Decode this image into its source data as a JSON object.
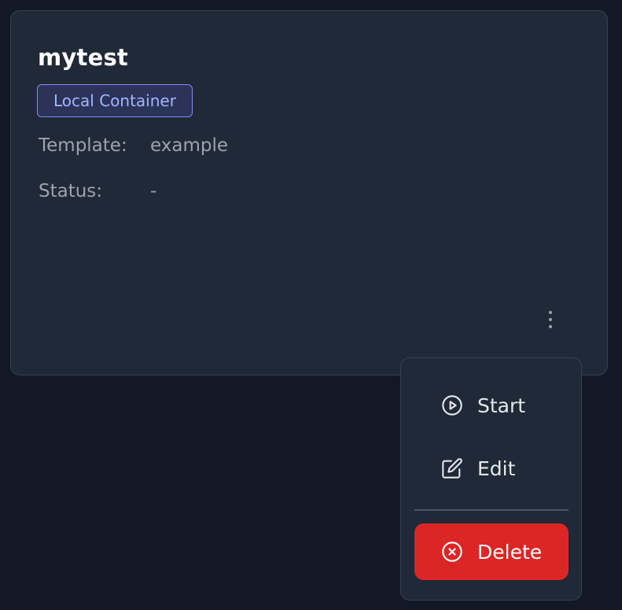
{
  "card": {
    "title": "mytest",
    "badge": "Local Container",
    "template_label": "Template:",
    "template_value": "example",
    "status_label": "Status:",
    "status_value": "-"
  },
  "menu": {
    "items": [
      {
        "label": "Start",
        "icon": "play-circle-icon"
      },
      {
        "label": "Edit",
        "icon": "edit-icon"
      },
      {
        "label": "Delete",
        "icon": "x-circle-icon"
      }
    ]
  },
  "colors": {
    "background": "#121826",
    "card": "#1f2937",
    "badge_border": "#818cf8",
    "badge_text": "#a5b4fc",
    "delete": "#dc2626"
  }
}
